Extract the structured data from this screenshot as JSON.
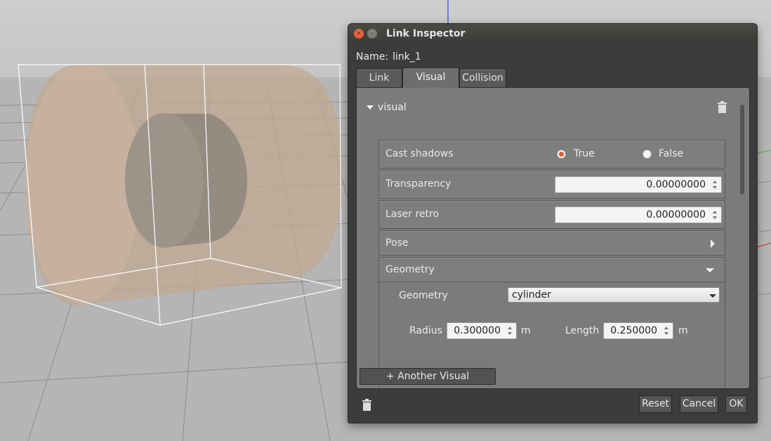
{
  "window": {
    "title": "Link Inspector"
  },
  "name_row": {
    "label": "Name:",
    "value": "link_1"
  },
  "tabs": [
    {
      "label": "Link",
      "active": false
    },
    {
      "label": "Visual",
      "active": true
    },
    {
      "label": "Collision",
      "active": false
    }
  ],
  "visual": {
    "section_label": "visual",
    "cast_shadows": {
      "label": "Cast shadows",
      "true_label": "True",
      "false_label": "False",
      "selected": "True"
    },
    "transparency": {
      "label": "Transparency",
      "value": "0.00000000"
    },
    "laser_retro": {
      "label": "Laser retro",
      "value": "0.00000000"
    },
    "pose": {
      "label": "Pose"
    },
    "geometry": {
      "label": "Geometry",
      "type_label": "Geometry",
      "type_value": "cylinder",
      "radius_label": "Radius",
      "radius_value": "0.300000",
      "radius_unit": "m",
      "length_label": "Length",
      "length_value": "0.250000",
      "length_unit": "m"
    }
  },
  "buttons": {
    "add_visual": "+ Another Visual",
    "reset": "Reset",
    "cancel": "Cancel",
    "ok": "OK"
  },
  "colors": {
    "accent_radio": "#e05a2b",
    "close_button": "#e4562f",
    "dialog_bg": "#3c3c3c",
    "panel_bg": "#7b7b7b",
    "viewport_ground": "#b9b9b9",
    "cylinder": "#c2aa93"
  },
  "icons": {
    "window_close": "close-icon",
    "window_minimize": "minimize-icon",
    "delete_visual": "trash-icon",
    "delete_link": "trash-icon",
    "pose_expand": "chevron-right-icon",
    "geometry_collapse": "chevron-down-icon"
  }
}
